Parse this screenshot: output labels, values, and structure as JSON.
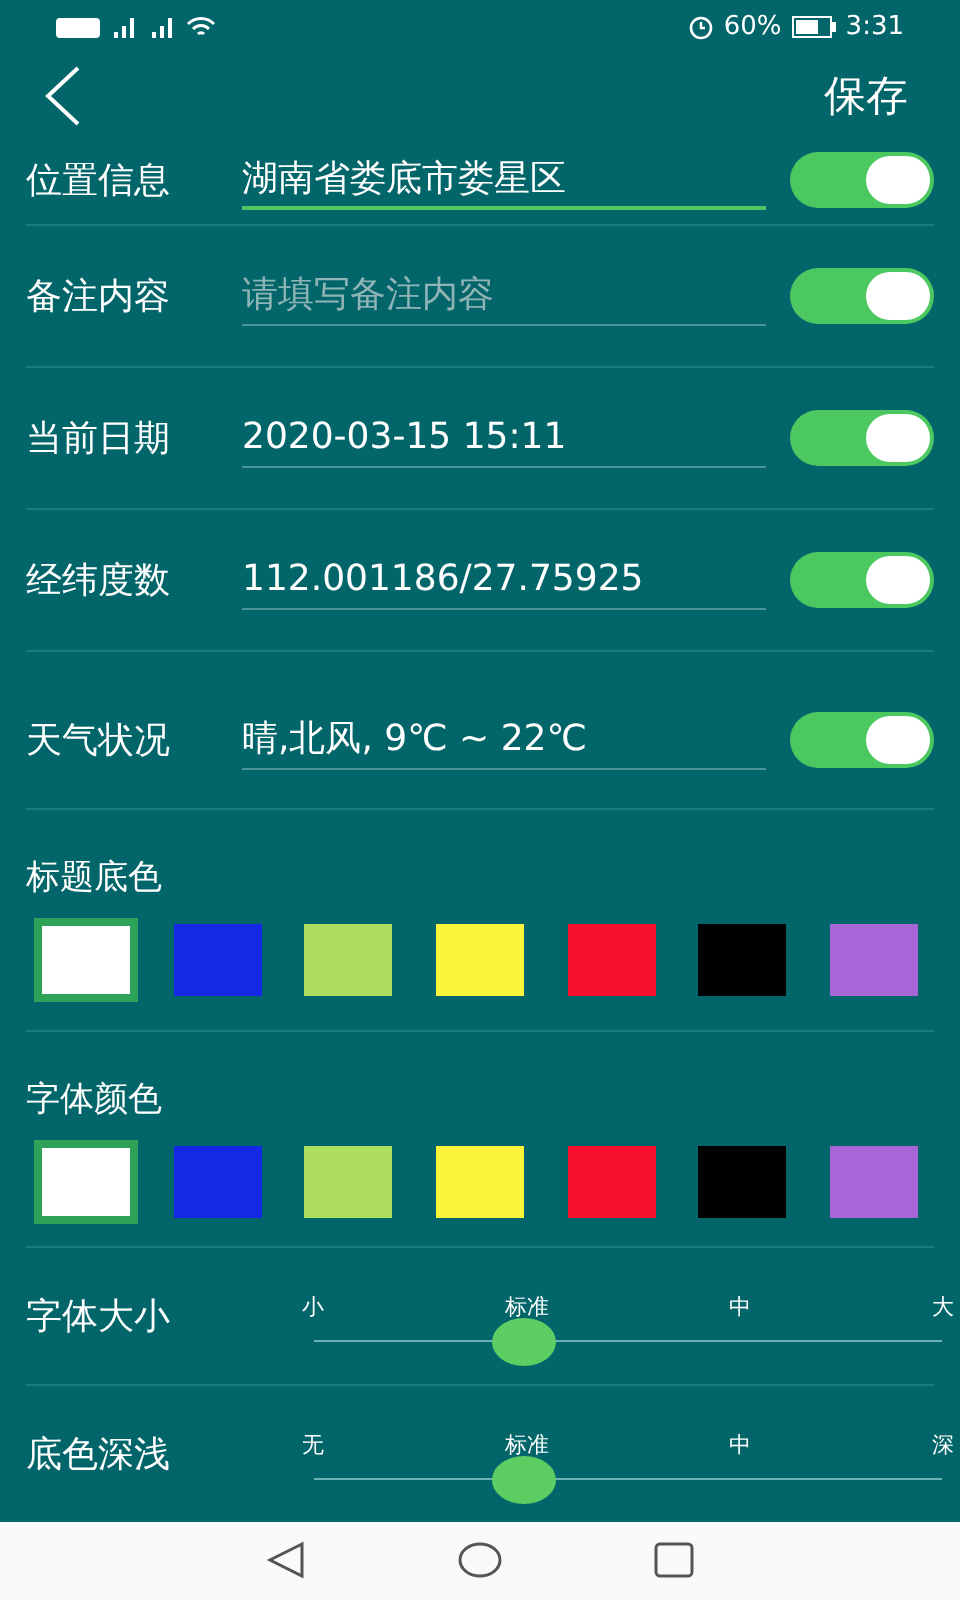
{
  "status_bar": {
    "battery_percent": "60%",
    "time": "3:31"
  },
  "header": {
    "save": "保存"
  },
  "fields": [
    {
      "label": "位置信息",
      "value": "湖南省娄底市娄星区",
      "focused": true,
      "on": true
    },
    {
      "label": "备注内容",
      "placeholder": "请填写备注内容",
      "focused": false,
      "on": true
    },
    {
      "label": "当前日期",
      "value": "2020-03-15 15:11",
      "focused": false,
      "on": true
    },
    {
      "label": "经纬度数",
      "value": "112.001186/27.75925",
      "focused": false,
      "on": true
    },
    {
      "label": "天气状况",
      "value": "晴,北风, 9℃ ~ 22℃",
      "focused": false,
      "on": true
    }
  ],
  "palettes": [
    {
      "title": "标题底色",
      "swatches": [
        {
          "color": "#ffffff",
          "selected": true
        },
        {
          "color": "#1428e6",
          "selected": false
        },
        {
          "color": "#aede60",
          "selected": false
        },
        {
          "color": "#fdf53a",
          "selected": false
        },
        {
          "color": "#f50f2d",
          "selected": false
        },
        {
          "color": "#000000",
          "selected": false
        },
        {
          "color": "#a866d8",
          "selected": false
        }
      ]
    },
    {
      "title": "字体颜色",
      "swatches": [
        {
          "color": "#ffffff",
          "selected": true
        },
        {
          "color": "#1428e6",
          "selected": false
        },
        {
          "color": "#aede60",
          "selected": false
        },
        {
          "color": "#fdf53a",
          "selected": false
        },
        {
          "color": "#f50f2d",
          "selected": false
        },
        {
          "color": "#000000",
          "selected": false
        },
        {
          "color": "#a866d8",
          "selected": false
        }
      ]
    }
  ],
  "sliders": [
    {
      "label": "字体大小",
      "ticks": [
        "小",
        "标准",
        "中",
        "大"
      ],
      "level": 0.333
    },
    {
      "label": "底色深浅",
      "ticks": [
        "无",
        "标准",
        "中",
        "深"
      ],
      "level": 0.333
    }
  ]
}
